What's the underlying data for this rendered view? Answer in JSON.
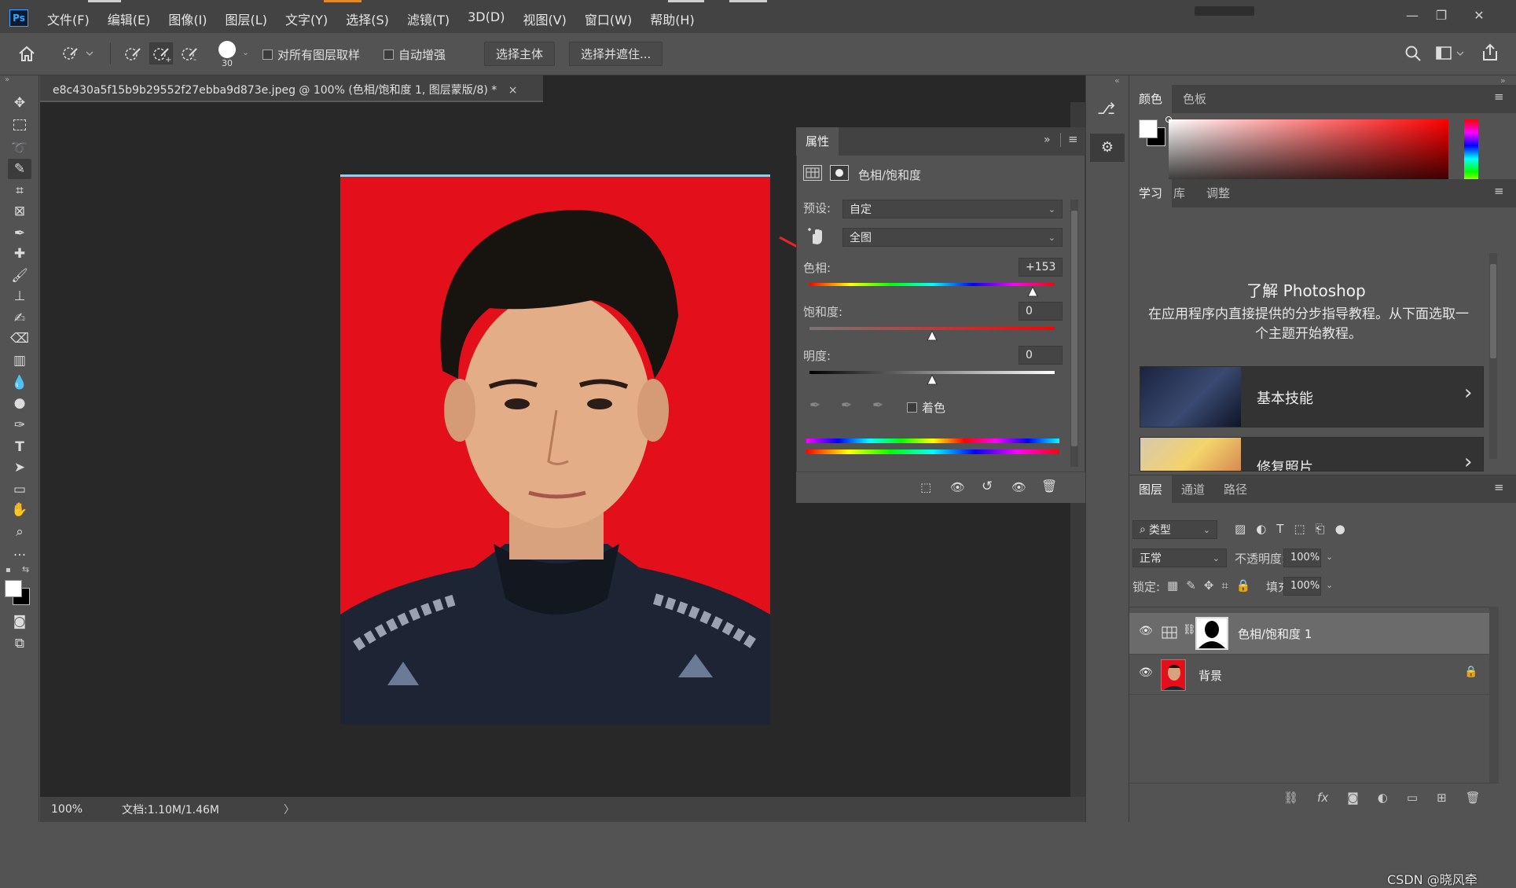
{
  "menubar": {
    "logo": "Ps",
    "items": [
      "文件(F)",
      "编辑(E)",
      "图像(I)",
      "图层(L)",
      "文字(Y)",
      "选择(S)",
      "滤镜(T)",
      "3D(D)",
      "视图(V)",
      "窗口(W)",
      "帮助(H)"
    ],
    "window_controls": [
      "—",
      "❐",
      "✕"
    ]
  },
  "options": {
    "brush_size": "30",
    "sample_all_layers": "对所有图层取样",
    "auto_enhance": "自动增强",
    "select_subject": "选择主体",
    "select_and_mask": "选择并遮住..."
  },
  "document": {
    "tab_title": "e8c430a5f15b9b29552f27ebba9d873e.jpeg @ 100% (色相/饱和度 1, 图层蒙版/8) *",
    "tab_close": "×",
    "zoom": "100%",
    "doc_info": "文档:1.10M/1.46M",
    "status_arrow": "〉"
  },
  "properties": {
    "tab": "属性",
    "adjustment_title": "色相/饱和度",
    "preset_label": "预设:",
    "preset_value": "自定",
    "range_value": "全图",
    "hue_label": "色相:",
    "hue_value": "+153",
    "saturation_label": "饱和度:",
    "saturation_value": "0",
    "lightness_label": "明度:",
    "lightness_value": "0",
    "colorize_label": "着色",
    "hue_level": 0.91,
    "saturation_level": 0.5,
    "lightness_level": 0.5
  },
  "color_panel": {
    "tabs": [
      "颜色",
      "色板"
    ],
    "hue_color": "#ff0000"
  },
  "learn_panel": {
    "tabs": [
      "学习",
      "库",
      "调整"
    ],
    "title": "了解 Photoshop",
    "description": "在应用程序内直接提供的分步指导教程。从下面选取一个主题开始教程。",
    "cards": [
      {
        "label": "基本技能",
        "arrow": "›"
      },
      {
        "label": "修复照片",
        "arrow": "›"
      }
    ]
  },
  "layers_panel": {
    "tabs": [
      "图层",
      "通道",
      "路径"
    ],
    "filter_label": "类型",
    "blend_mode": "正常",
    "opacity_label": "不透明度:",
    "opacity_value": "100%",
    "lock_label": "锁定:",
    "fill_label": "填充:",
    "fill_value": "100%",
    "layers": [
      {
        "name": "色相/饱和度 1",
        "selected": true
      },
      {
        "name": "背景",
        "selected": false
      }
    ]
  },
  "watermark": "CSDN @晓风牵"
}
